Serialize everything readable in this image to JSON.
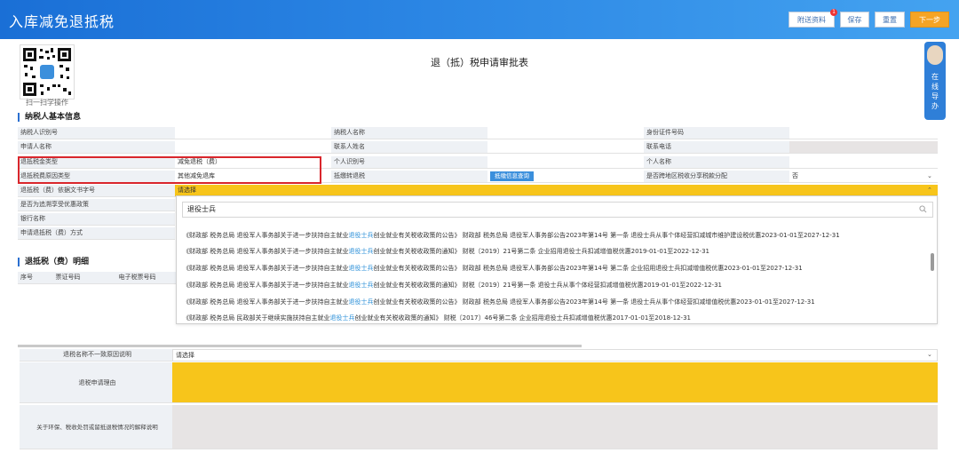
{
  "app": {
    "title": "入库减免退抵税"
  },
  "toolbar": {
    "attach": "附送资料",
    "attach_badge": "1",
    "save": "保存",
    "reset": "重置",
    "next": "下一步"
  },
  "qr": {
    "caption": "扫一扫学操作"
  },
  "form": {
    "title": "退（抵）税申请审批表"
  },
  "helper": {
    "label": "在线导办"
  },
  "section1": {
    "title": "纳税人基本信息"
  },
  "basic": {
    "taxpayer_id_label": "纳税人识别号",
    "taxpayer_name_label": "纳税人名称",
    "id_number_label": "身份证件号码",
    "applicant_name_label": "申请人名称",
    "contact_name_label": "联系人姓名",
    "contact_phone_label": "联系电话",
    "refund_type_label": "退抵税金类型",
    "refund_type_value": "减免退税（费）",
    "personal_id_label": "个人识别号",
    "personal_name_label": "个人名称",
    "reason_type_label": "退抵税费原因类型",
    "reason_type_value": "其他减免退库",
    "offset_label": "抵缴转退税",
    "query_btn": "抵缴信息查询",
    "region_label": "是否跨地区税收分享税款分配",
    "region_value": "否",
    "basis_doc_label": "退抵税（费）依据文书字号",
    "basis_doc_value": "请选择",
    "retro_label": "是否为追溯享受优惠政策",
    "bank_label": "银行名称",
    "method_label": "申请退抵税（费）方式"
  },
  "dropdown": {
    "search_value": "退役士兵",
    "options": [
      {
        "pre": "《财政部 税务总局 退役军人事务部关于进一步扶持自主就业",
        "hl": "退役士兵",
        "post": "创业就业有关税收政策的公告》 财政部 税务总局 退役军人事务部公告2023年第14号 第一条 退役士兵从事个体经营扣减城市维护建设税优惠2023-01-01至2027-12-31"
      },
      {
        "pre": "《财政部 税务总局 退役军人事务部关于进一步扶持自主就业",
        "hl": "退役士兵",
        "post": "创业就业有关税收政策的通知》 财税〔2019〕21号第二条 企业招用退役士兵扣减增值税优惠2019-01-01至2022-12-31"
      },
      {
        "pre": "《财政部 税务总局 退役军人事务部关于进一步扶持自主就业",
        "hl": "退役士兵",
        "post": "创业就业有关税收政策的公告》 财政部 税务总局 退役军人事务部公告2023年第14号 第二条 企业招用退役士兵扣减增值税优惠2023-01-01至2027-12-31"
      },
      {
        "pre": "《财政部 税务总局 退役军人事务部关于进一步扶持自主就业",
        "hl": "退役士兵",
        "post": "创业就业有关税收政策的通知》 财税〔2019〕21号第一条 退役士兵从事个体经营扣减增值税优惠2019-01-01至2022-12-31"
      },
      {
        "pre": "《财政部 税务总局 退役军人事务部关于进一步扶持自主就业",
        "hl": "退役士兵",
        "post": "创业就业有关税收政策的公告》 财政部 税务总局 退役军人事务部公告2023年第14号 第一条 退役士兵从事个体经营扣减增值税优惠2023-01-01至2027-12-31"
      },
      {
        "pre": "《财政部 税务总局 民政部关于继续实施扶持自主就业",
        "hl": "退役士兵",
        "post": "创业就业有关税收政策的通知》 财税〔2017〕46号第二条 企业招用退役士兵扣减增值税优惠2017-01-01至2018-12-31"
      }
    ]
  },
  "section2": {
    "title": "退抵税（费）明细"
  },
  "detail_cols": {
    "seq": "序号",
    "ticket_no": "票证号码",
    "e_ticket_no": "电子税票号码"
  },
  "bottom": {
    "mismatch_label": "退税名称不一致原因说明",
    "mismatch_value": "请选择",
    "reason_label": "退税申请理由",
    "explain_label": "关于环保、税收处罚或留抵退税情况的解释说明"
  }
}
